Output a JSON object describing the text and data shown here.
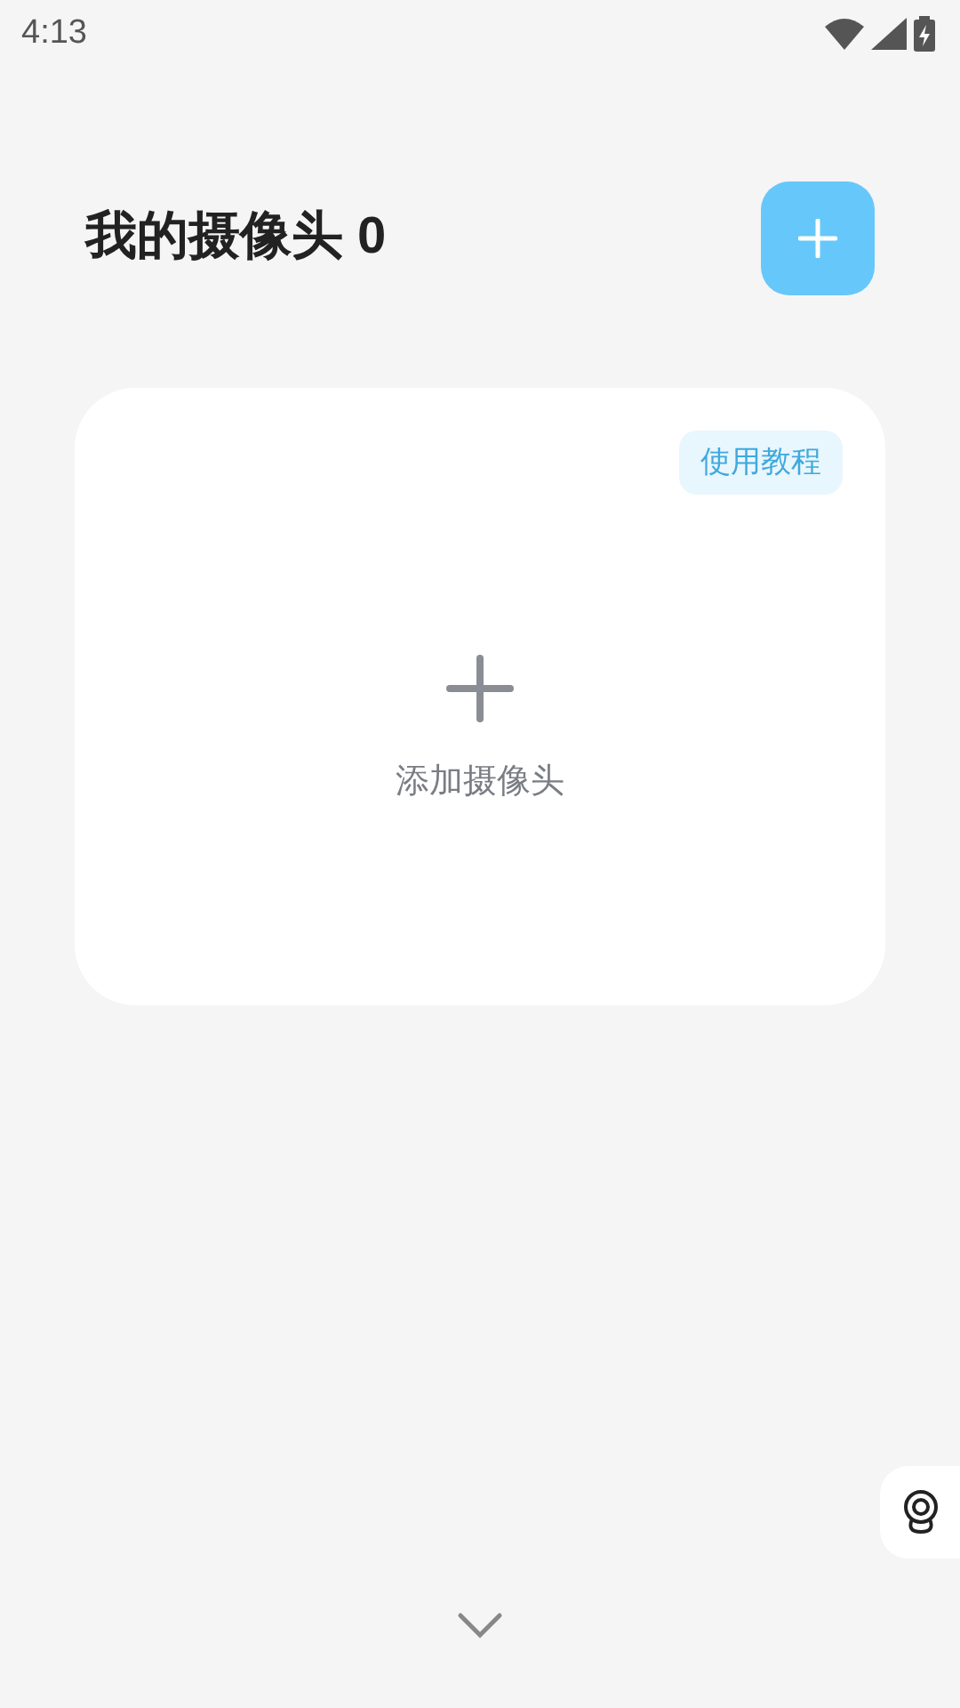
{
  "status_bar": {
    "time": "4:13"
  },
  "header": {
    "title": "我的摄像头 0"
  },
  "card": {
    "badge": "使用教程",
    "add_label": "添加摄像头"
  }
}
